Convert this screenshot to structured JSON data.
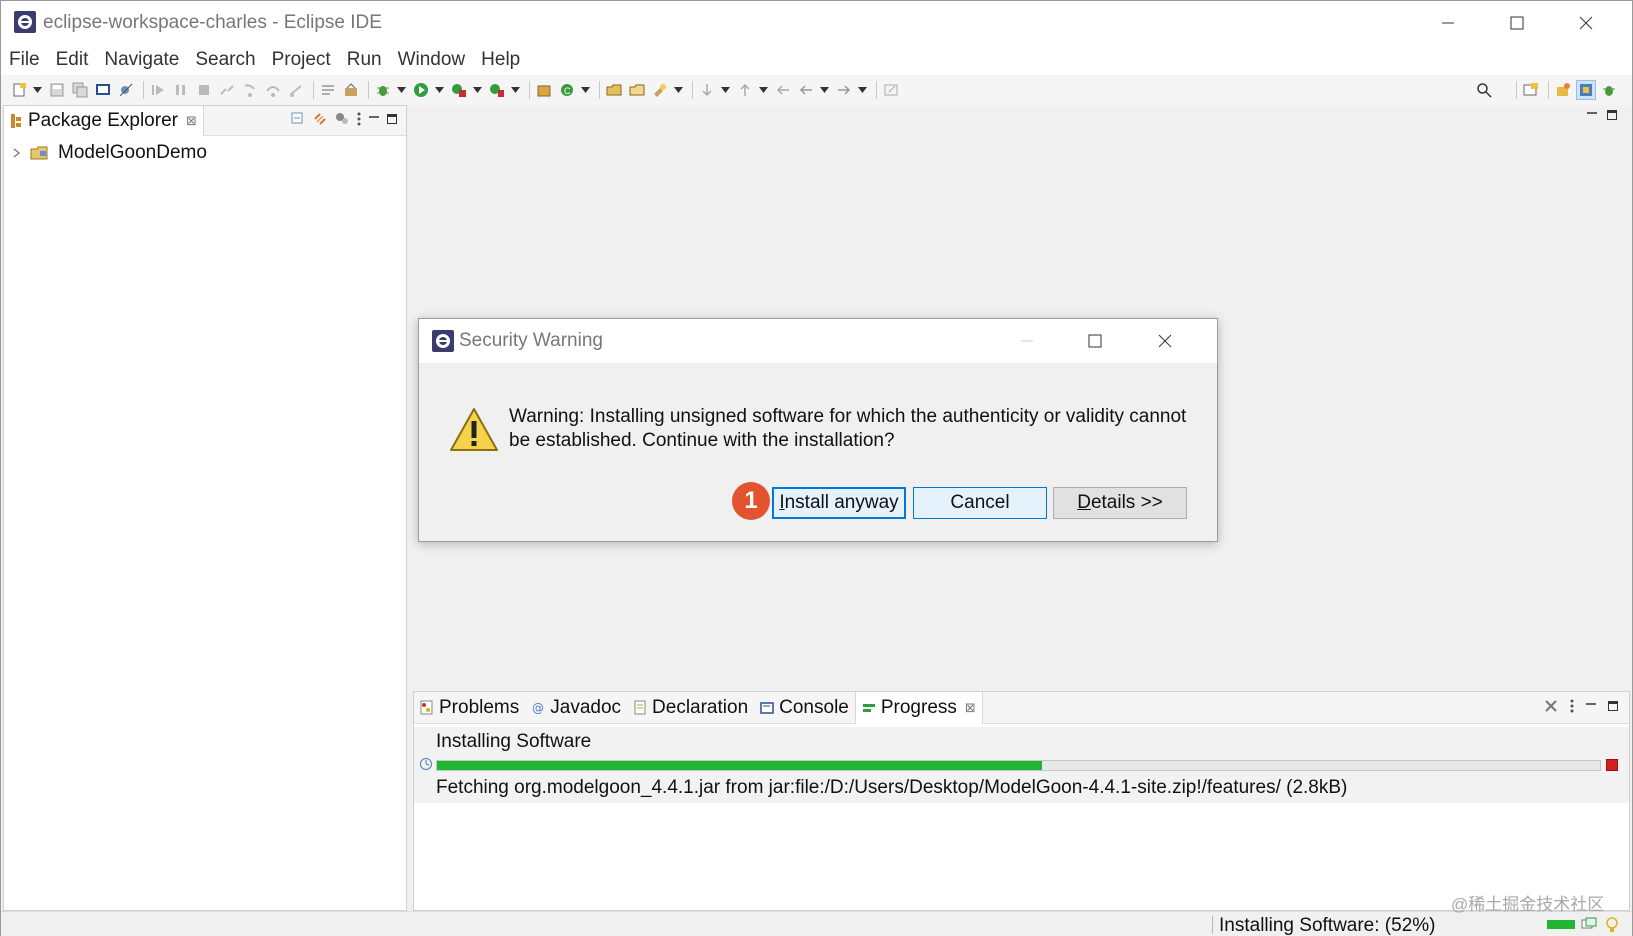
{
  "window": {
    "title": "eclipse-workspace-charles - Eclipse IDE",
    "controls": {
      "minimize": "─",
      "maximize": "☐",
      "close": "✕"
    }
  },
  "menu": {
    "items": [
      "File",
      "Edit",
      "Navigate",
      "Search",
      "Project",
      "Run",
      "Window",
      "Help"
    ]
  },
  "package_explorer": {
    "tab_label": "Package Explorer",
    "tree": [
      {
        "label": "ModelGoonDemo",
        "expanded": false
      }
    ]
  },
  "bottom_panel": {
    "tabs": [
      {
        "label": "Problems",
        "icon": "problems-icon",
        "active": false
      },
      {
        "label": "Javadoc",
        "icon": "javadoc-icon",
        "active": false
      },
      {
        "label": "Declaration",
        "icon": "declaration-icon",
        "active": false
      },
      {
        "label": "Console",
        "icon": "console-icon",
        "active": false
      },
      {
        "label": "Progress",
        "icon": "progress-icon",
        "active": true
      }
    ],
    "progress": {
      "title": "Installing Software",
      "fraction": 0.52,
      "detail": "Fetching org.modelgoon_4.4.1.jar from jar:file:/D:/Users/Desktop/ModelGoon-4.4.1-site.zip!/features/ (2.8kB)"
    }
  },
  "status_bar": {
    "text": "Installing Software: (52%)",
    "watermark": "@稀土掘金技术社区"
  },
  "dialog": {
    "title": "Security Warning",
    "message": "Warning: Installing unsigned software for which the authenticity or validity cannot be established. Continue with the installation?",
    "buttons": [
      {
        "label": "Install anyway",
        "mnemonic": "I",
        "rest": "nstall anyway"
      },
      {
        "label": "Cancel"
      },
      {
        "label": "Details >>",
        "mnemonic": "D",
        "rest": "etails >>"
      }
    ],
    "step_badge": "1"
  },
  "colors": {
    "accent": "#0078d7",
    "progress_fill": "#22b534",
    "badge": "#e2532f",
    "stop": "#d21f1f"
  }
}
